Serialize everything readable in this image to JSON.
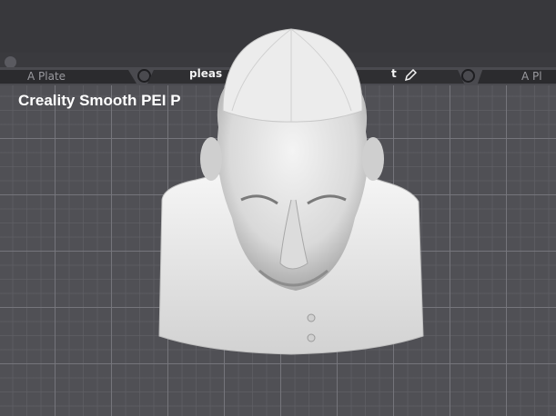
{
  "plates": {
    "left_tab_label": "A Plate",
    "right_tab_label": "A Pl",
    "current_plate_name": "pleas",
    "current_plate_name_tail": "t"
  },
  "bed": {
    "plate_type_label": "Creality Smooth PEI P"
  },
  "icons": {
    "edit": "pencil-icon",
    "plate_settings": "circle-icon"
  },
  "colors": {
    "background": "#3a3a3e",
    "bed": "#505055",
    "model": "#e8e8e8"
  }
}
